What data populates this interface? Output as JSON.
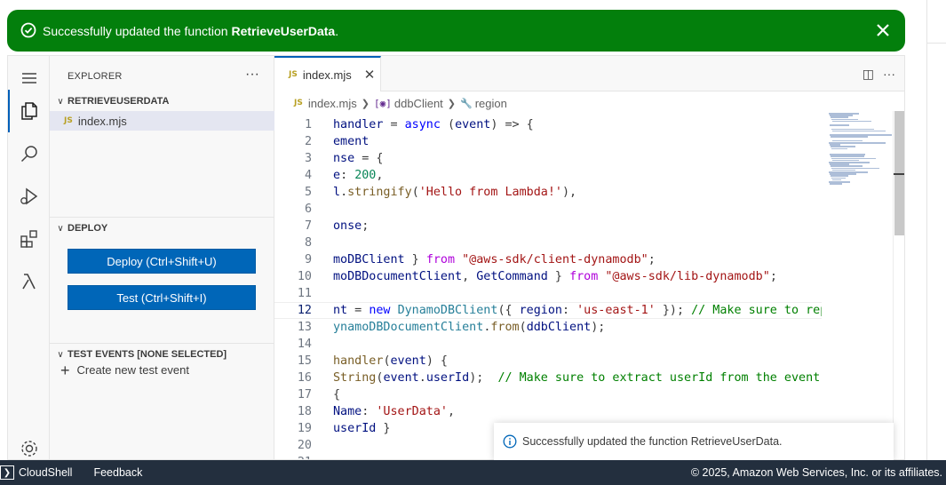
{
  "banner": {
    "message_prefix": "Successfully updated the function ",
    "function_name": "RetrieveUserData",
    "message_suffix": ".",
    "color": "#037f0c"
  },
  "sidebar": {
    "title": "EXPLORER",
    "more": "···",
    "folder": "RETRIEVEUSERDATA",
    "file": "index.mjs",
    "deploy_section": "DEPLOY",
    "deploy_button": "Deploy (Ctrl+Shift+U)",
    "test_button": "Test (Ctrl+Shift+I)",
    "test_events_section": "TEST EVENTS [NONE SELECTED]",
    "create_test_event": "Create new test event"
  },
  "editor": {
    "tab_label": "index.mjs",
    "file_badge": "JS",
    "breadcrumb": [
      "index.mjs",
      "ddbClient",
      "region"
    ],
    "active_line": 12,
    "lines": [
      {
        "n": "1",
        "html": "<span class=\"var\">handler</span> = <span class=\"kw\">async</span> (<span class=\"var\">event</span>) => {"
      },
      {
        "n": "2",
        "html": "<span class=\"var\">ement</span>"
      },
      {
        "n": "3",
        "html": "<span class=\"var\">nse</span> = {"
      },
      {
        "n": "4",
        "html": "<span class=\"var\">e</span>: <span class=\"num\">200</span>,"
      },
      {
        "n": "5",
        "html": "<span class=\"var\">l</span>.<span class=\"fn\">stringify</span>(<span class=\"str\">'Hello from Lambda!'</span>),"
      },
      {
        "n": "6",
        "html": ""
      },
      {
        "n": "7",
        "html": "<span class=\"var\">onse</span>;"
      },
      {
        "n": "8",
        "html": ""
      },
      {
        "n": "9",
        "html": "<span class=\"var\">moDBClient</span> } <span class=\"kw2\">from</span> <span class=\"str\">\"@aws-sdk/client-dynamodb\"</span>;"
      },
      {
        "n": "10",
        "html": "<span class=\"var\">moDBDocumentClient</span>, <span class=\"var\">GetCommand</span> } <span class=\"kw2\">from</span> <span class=\"str\">\"@aws-sdk/lib-dynamodb\"</span>;"
      },
      {
        "n": "11",
        "html": ""
      },
      {
        "n": "12",
        "html": "<span class=\"var\">nt</span> = <span class=\"kw\">new</span> <span class=\"cls\">DynamoDBClient</span>({ <span class=\"var\">region</span>: <span class=\"str\">'us-east-1'</span> }); <span class=\"cm\">// Make sure to replac</span>"
      },
      {
        "n": "13",
        "html": "<span class=\"cls\">ynamoDBDocumentClient</span>.<span class=\"fn\">from</span>(<span class=\"var\">ddbClient</span>);"
      },
      {
        "n": "14",
        "html": ""
      },
      {
        "n": "15",
        "html": "<span class=\"fn\">handler</span>(<span class=\"var\">event</span>) {"
      },
      {
        "n": "16",
        "html": "<span class=\"fn\">String</span>(<span class=\"var\">event</span>.<span class=\"var\">userId</span>);  <span class=\"cm\">// Make sure to extract userId from the event</span>"
      },
      {
        "n": "17",
        "html": "{"
      },
      {
        "n": "18",
        "html": "<span class=\"var\">Name</span>: <span class=\"str\">'UserData'</span>,"
      },
      {
        "n": "19",
        "html": "<span class=\"var\">userId</span> }"
      },
      {
        "n": "20",
        "html": ""
      },
      {
        "n": "21",
        "html": ""
      }
    ]
  },
  "toast": {
    "message": "Successfully updated the function RetrieveUserData."
  },
  "footer": {
    "cloudshell": "CloudShell",
    "feedback": "Feedback",
    "copyright": "© 2025, Amazon Web Services, Inc. or its affiliates."
  },
  "colors": {
    "accent": "#005fb8",
    "button": "#0066b8",
    "footer_bg": "#232f3e"
  }
}
